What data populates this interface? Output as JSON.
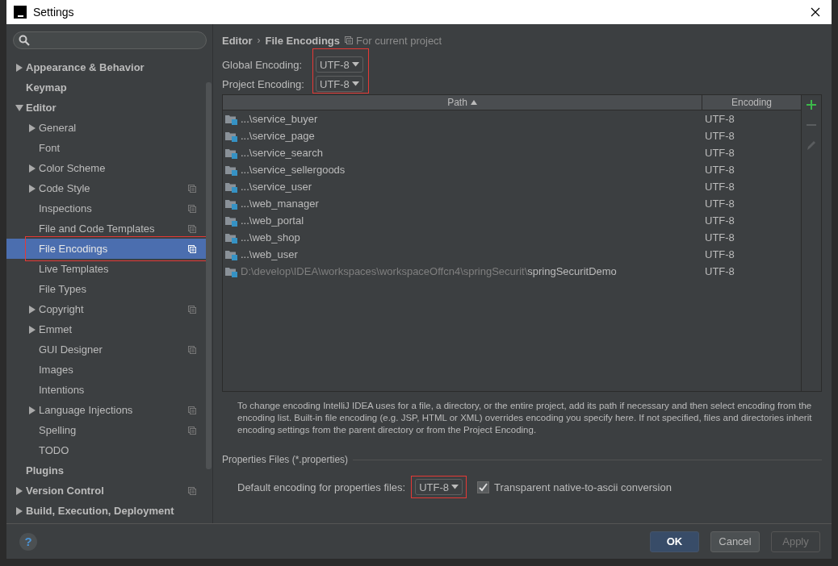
{
  "window": {
    "title": "Settings"
  },
  "sidebar": {
    "items": [
      {
        "label": "Appearance & Behavior",
        "bold": true,
        "expandable": true,
        "expanded": false,
        "selected": false,
        "per_project": false
      },
      {
        "label": "Keymap",
        "bold": true,
        "expandable": false,
        "selected": false,
        "per_project": false
      },
      {
        "label": "Editor",
        "bold": true,
        "expandable": true,
        "expanded": true,
        "selected": false,
        "per_project": false,
        "children": [
          {
            "label": "General",
            "expandable": true,
            "expanded": false,
            "selected": false,
            "per_project": false
          },
          {
            "label": "Font",
            "expandable": false,
            "selected": false,
            "per_project": false
          },
          {
            "label": "Color Scheme",
            "expandable": true,
            "expanded": false,
            "selected": false,
            "per_project": false
          },
          {
            "label": "Code Style",
            "expandable": true,
            "expanded": false,
            "selected": false,
            "per_project": true
          },
          {
            "label": "Inspections",
            "expandable": false,
            "selected": false,
            "per_project": true
          },
          {
            "label": "File and Code Templates",
            "expandable": false,
            "selected": false,
            "per_project": true
          },
          {
            "label": "File Encodings",
            "expandable": false,
            "selected": true,
            "per_project": true,
            "highlighted": true
          },
          {
            "label": "Live Templates",
            "expandable": false,
            "selected": false,
            "per_project": false
          },
          {
            "label": "File Types",
            "expandable": false,
            "selected": false,
            "per_project": false
          },
          {
            "label": "Copyright",
            "expandable": true,
            "expanded": false,
            "selected": false,
            "per_project": true
          },
          {
            "label": "Emmet",
            "expandable": true,
            "expanded": false,
            "selected": false,
            "per_project": false
          },
          {
            "label": "GUI Designer",
            "expandable": false,
            "selected": false,
            "per_project": true
          },
          {
            "label": "Images",
            "expandable": false,
            "selected": false,
            "per_project": false
          },
          {
            "label": "Intentions",
            "expandable": false,
            "selected": false,
            "per_project": false
          },
          {
            "label": "Language Injections",
            "expandable": true,
            "expanded": false,
            "selected": false,
            "per_project": true
          },
          {
            "label": "Spelling",
            "expandable": false,
            "selected": false,
            "per_project": true
          },
          {
            "label": "TODO",
            "expandable": false,
            "selected": false,
            "per_project": false
          }
        ]
      },
      {
        "label": "Plugins",
        "bold": true,
        "expandable": false,
        "selected": false,
        "per_project": false
      },
      {
        "label": "Version Control",
        "bold": true,
        "expandable": true,
        "expanded": false,
        "selected": false,
        "per_project": true
      },
      {
        "label": "Build, Execution, Deployment",
        "bold": true,
        "expandable": true,
        "expanded": false,
        "selected": false,
        "per_project": false
      }
    ]
  },
  "breadcrumb": {
    "parent": "Editor",
    "separator": "›",
    "current": "File Encodings",
    "scope": "For current project"
  },
  "encodings": {
    "highlighted": true,
    "fields": [
      {
        "label": "Global Encoding:",
        "value": "UTF-8"
      },
      {
        "label": "Project Encoding:",
        "value": "UTF-8"
      }
    ]
  },
  "table": {
    "columns": [
      {
        "title": "Path",
        "sort_ascending": true
      },
      {
        "title": "Encoding"
      }
    ],
    "rows": [
      {
        "name": "...\\service_buyer",
        "encoding": "UTF-8"
      },
      {
        "name": "...\\service_page",
        "encoding": "UTF-8"
      },
      {
        "name": "...\\service_search",
        "encoding": "UTF-8"
      },
      {
        "name": "...\\service_sellergoods",
        "encoding": "UTF-8"
      },
      {
        "name": "...\\service_user",
        "encoding": "UTF-8"
      },
      {
        "name": "...\\web_manager",
        "encoding": "UTF-8"
      },
      {
        "name": "...\\web_portal",
        "encoding": "UTF-8"
      },
      {
        "name": "...\\web_shop",
        "encoding": "UTF-8"
      },
      {
        "name": "...\\web_user",
        "encoding": "UTF-8"
      },
      {
        "prefix": "D:\\develop\\IDEA\\workspaces\\workspaceOffcn4\\springSecurit\\",
        "name": "springSecuritDemo",
        "encoding": "UTF-8"
      }
    ],
    "toolbar": [
      {
        "kind": "add",
        "disabled": false
      },
      {
        "kind": "remove",
        "disabled": true
      },
      {
        "kind": "edit",
        "disabled": true
      }
    ]
  },
  "description": "To change encoding IntelliJ IDEA uses for a file, a directory, or the entire project, add its path if necessary and then select encoding from the encoding list. Built-in file encoding (e.g. JSP, HTML or XML) overrides encoding you specify here. If not specified, files and directories inherit encoding settings from the parent directory or from the Project Encoding.",
  "properties": {
    "title": "Properties Files (*.properties)",
    "label": "Default encoding for properties files:",
    "value": "UTF-8",
    "highlighted": true,
    "checkbox": {
      "label": "Transparent native-to-ascii conversion",
      "checked": true
    }
  },
  "buttons": [
    {
      "label": "OK",
      "kind": "default",
      "disabled": false
    },
    {
      "label": "Cancel",
      "kind": "normal",
      "disabled": false
    },
    {
      "label": "Apply",
      "kind": "normal",
      "disabled": true
    }
  ],
  "help": {
    "label": "?"
  }
}
